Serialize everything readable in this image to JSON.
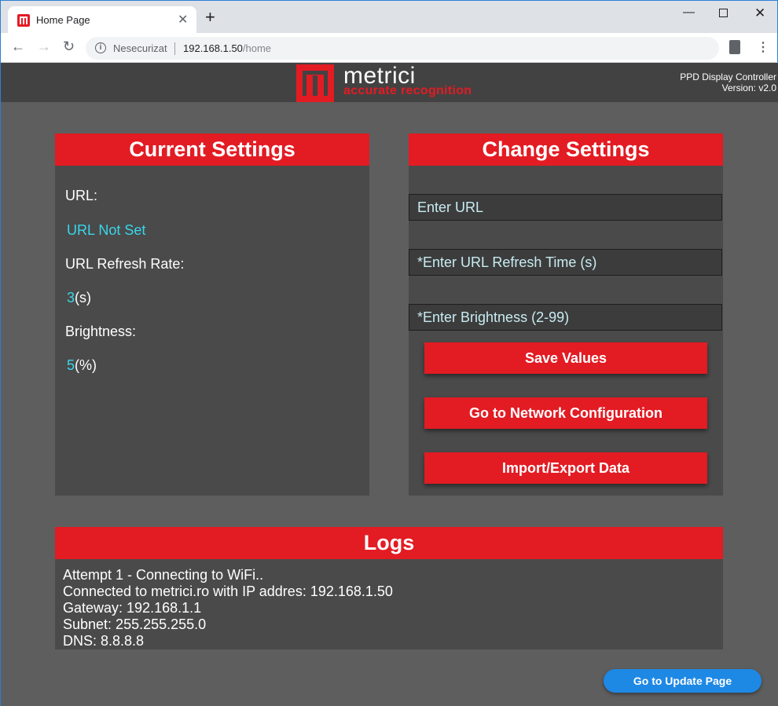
{
  "browser": {
    "tab_title": "Home Page",
    "security_label": "Nesecurizat",
    "url_host": "192.168.1.50",
    "url_path": "/home"
  },
  "header": {
    "brand_name": "metrici",
    "brand_tagline": "accurate recognition",
    "device_name": "PPD Display Controller",
    "version": "Version: v2.0"
  },
  "current_settings": {
    "title": "Current Settings",
    "url_label": "URL:",
    "url_value": "URL Not Set",
    "refresh_label": "URL Refresh Rate:",
    "refresh_value": "3",
    "refresh_unit": "(s)",
    "brightness_label": "Brightness:",
    "brightness_value": "5",
    "brightness_unit": "(%)"
  },
  "change_settings": {
    "title": "Change Settings",
    "url_placeholder": "Enter URL",
    "refresh_placeholder": "*Enter URL Refresh Time (s)",
    "brightness_placeholder": "*Enter Brightness (2-99)",
    "save_label": "Save Values",
    "network_label": "Go to Network Configuration",
    "import_export_label": "Import/Export Data"
  },
  "logs": {
    "title": "Logs",
    "lines": [
      "Attempt 1 - Connecting to WiFi..",
      "Connected to metrici.ro with IP addres: 192.168.1.50",
      "Gateway: 192.168.1.1",
      "Subnet: 255.255.255.0",
      "DNS: 8.8.8.8"
    ]
  },
  "update_button_label": "Go to Update Page",
  "colors": {
    "accent_red": "#e31b23",
    "value_cyan": "#38d6ea",
    "update_blue": "#1e88e5",
    "panel_bg": "#4a4a4a",
    "page_bg": "#5e5e5e"
  }
}
